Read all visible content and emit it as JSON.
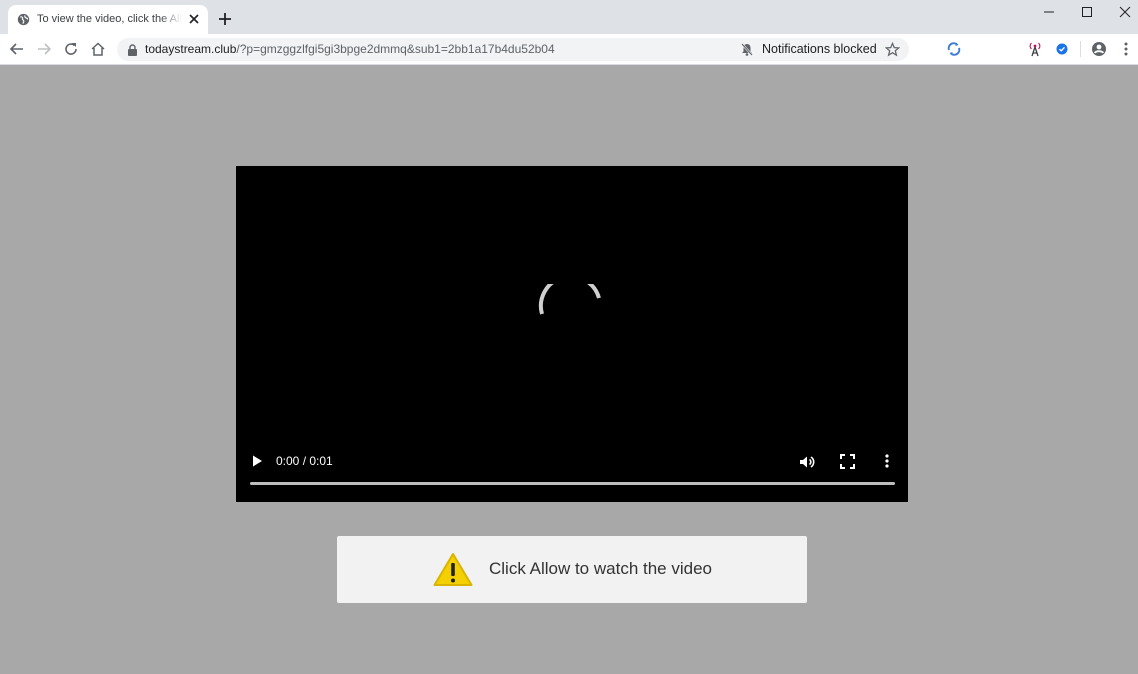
{
  "browser": {
    "tab": {
      "title": "To view the video, click the Allow button"
    },
    "address": {
      "host": "todaystream.club",
      "path": "/?p=gmzggzlfgi5gi3bpge2dmmq&sub1=2bb1a17b4du52b04"
    },
    "notifications_chip": "Notifications blocked",
    "icons": {
      "favicon": "globe-icon",
      "close": "close-icon",
      "new_tab": "plus-icon",
      "back": "arrow-left-icon",
      "forward": "arrow-right-icon",
      "reload": "reload-icon",
      "home": "home-icon",
      "lock": "lock-icon",
      "bell_off": "bell-off-icon",
      "bookmark": "star-icon",
      "profile": "account-circle-icon",
      "menu": "kebab-menu-icon"
    }
  },
  "player": {
    "time": "0:00 / 0:01",
    "progress_fraction": 0.0,
    "icons": {
      "spinner": "loading-spinner-icon",
      "play": "play-icon",
      "volume": "volume-icon",
      "fullscreen": "fullscreen-icon",
      "more": "more-vert-icon"
    }
  },
  "prompt": {
    "text": "Click Allow to watch the video",
    "icon": "warning-icon"
  },
  "colors": {
    "page_background": "#a8a8a8",
    "warning_yellow": "#f5d000"
  }
}
